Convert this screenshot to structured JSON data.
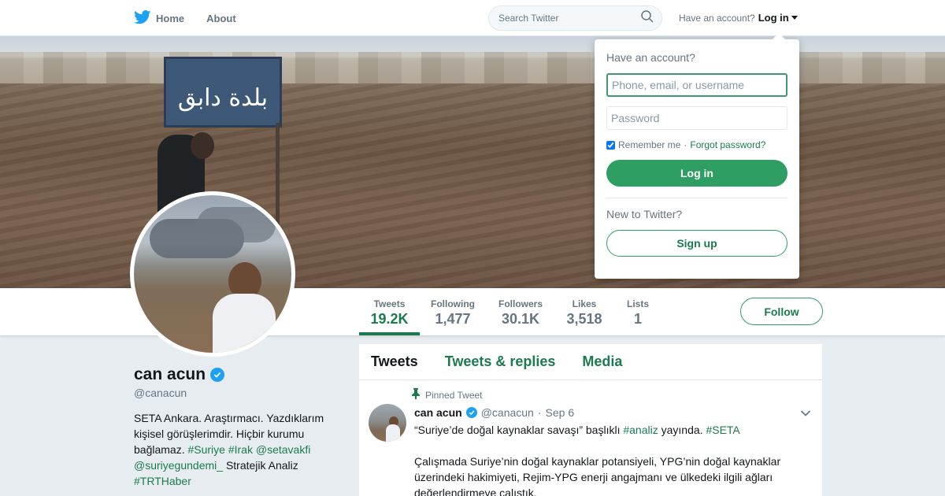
{
  "nav": {
    "home_label": "Home",
    "about_label": "About",
    "search_placeholder": "Search Twitter",
    "account_prompt": "Have an account?",
    "login_label": "Log in"
  },
  "banner": {
    "sign_text": "بلدة دابق"
  },
  "login_dropdown": {
    "title": "Have an account?",
    "username_placeholder": "Phone, email, or username",
    "password_placeholder": "Password",
    "remember_label": "Remember me",
    "separator": "·",
    "forgot_label": "Forgot password?",
    "login_button": "Log in",
    "new_prompt": "New to Twitter?",
    "signup_button": "Sign up",
    "remember_checked": true
  },
  "stats": [
    {
      "label": "Tweets",
      "value": "19.2K"
    },
    {
      "label": "Following",
      "value": "1,477"
    },
    {
      "label": "Followers",
      "value": "30.1K"
    },
    {
      "label": "Likes",
      "value": "3,518"
    },
    {
      "label": "Lists",
      "value": "1"
    }
  ],
  "follow_button": "Follow",
  "profile": {
    "name": "can acun",
    "handle": "@canacun",
    "bio_text_1": "SETA Ankara. Araştırmacı. Yazdıklarım kişisel görüşlerimdir. Hiçbir kurumu bağlamaz.",
    "bio_tag_1": "#Suriye",
    "bio_tag_2": "#Irak",
    "bio_mention_1": "@setavakfi",
    "bio_mention_2": "@suriyegundemi_",
    "bio_text_2": "Stratejik Analiz",
    "bio_tag_3": "#TRTHaber"
  },
  "timeline": {
    "tabs": [
      "Tweets",
      "Tweets & replies",
      "Media"
    ],
    "pinned_label": "Pinned Tweet",
    "tweet": {
      "name": "can acun",
      "handle": "@canacun",
      "separator": "·",
      "time": "Sep 6",
      "text_1a": "“Suriye’de doğal kaynaklar savaşı” başlıklı",
      "tag_1": "#analiz",
      "text_1b": "yayında.",
      "tag_2": "#SETA",
      "text_2": "Çalışmada Suriye’nin doğal kaynaklar potansiyeli, YPG’nin doğal kaynaklar üzerindeki hakimiyeti, Rejim-YPG enerji angajmanı ve ülkedeki ilgili ağları değerlendirmeye çalıştık."
    }
  },
  "colors": {
    "accent": "#1b7b4f",
    "accent_button": "#2e9e62",
    "verified": "#1da1f2",
    "twitter_bird": "#1da1f2"
  },
  "icons": [
    "twitter-bird-icon",
    "home-icon",
    "search-icon",
    "caret-down-icon",
    "verified-icon",
    "pin-icon",
    "chevron-down-icon"
  ]
}
